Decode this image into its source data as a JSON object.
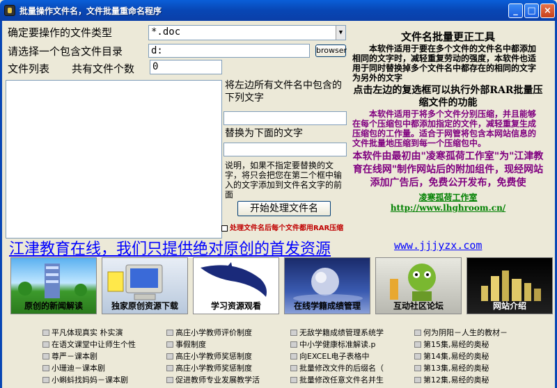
{
  "window": {
    "title": "批量操作文件名，文件批量重命名程序",
    "minimize": "_",
    "maximize": "□",
    "close": "×"
  },
  "form": {
    "file_type_label": "确定要操作的文件类型",
    "file_type_value": "*.doc",
    "dir_label": "请选择一个包含文件目录",
    "dir_value": "d:",
    "browse_button": "browser",
    "file_list_label": "文件列表",
    "count_label": "共有文件个数",
    "count_value": "0",
    "find_label": "将左边所有文件名中包含的下列文字",
    "replace_label": "替换为下面的文字",
    "note": "说明，如果不指定要替换的文字，将只会把您在第二个框中输入的文字添加到文件名文字的前面",
    "start_button": "开始处理文件名",
    "rar_checkbox": "处理文件名后每个文件都用RAR压缩"
  },
  "info": {
    "title": "文件名批量更正工具",
    "para1": "本软件适用于要在多个文件的文件名中都添加相同的文字时，减轻重复劳动的强度，本软件也适用于同时替换掉多个文件名中都存在的相同的文字为另外的文字",
    "title2": "点击左边的复选框可以执行外部RAR批量压缩文件的功能",
    "para2": "本软件适用于将多个文件分别压缩，并且能够在每个压缩包中都添加指定的文件，减轻重复生成压缩包的工作量。适合于网管将包含本网站信息的文件批量地压缩到每一个压缩包中。",
    "para3": "本软件由最初由\"凌寒孤荷工作室\"为\"江津教育在线网\"制作网站后的附加组件，现经网站添加广告后，免费公开发布，免费使",
    "studio": "凌寒孤荷工作室",
    "url": "http://www.lhghroom.cn/"
  },
  "banner": {
    "text": "江津教育在线，我们只提供绝对原创的首发资源",
    "url": "www.jjjyzx.com"
  },
  "nav": [
    {
      "label": "原创的新闻解读"
    },
    {
      "label": "独家原创资源下载"
    },
    {
      "label": "学习资源观看"
    },
    {
      "label": "在线学籍成绩管理"
    },
    {
      "label": "互动社区论坛"
    },
    {
      "label": "网站介绍"
    }
  ],
  "links": [
    [
      "平凡体现真实 朴实演",
      "在语文课堂中让师生个性",
      "尊严－课本剧",
      "小珊迪－课本剧",
      "小蝌蚪找妈妈－课本剧"
    ],
    [
      "高庄小学教师评价制度",
      "事假制度",
      "高庄小学教师奖惩制度",
      "高庄小学教师奖惩制度",
      "促进教师专业发展教学活"
    ],
    [
      "无敌学籍成绩管理系统学",
      "中小学健康标准解读.p",
      "向EXCEL电子表格中",
      "批量修改文件的后缀名（",
      "批量修改任意文件名并生"
    ],
    [
      "何为阴阳－人生的教材－",
      "第15集,易经的奥秘",
      "第14集,易经的奥秘",
      "第13集,易经的奥秘",
      "第12集,易经的奥秘"
    ]
  ]
}
